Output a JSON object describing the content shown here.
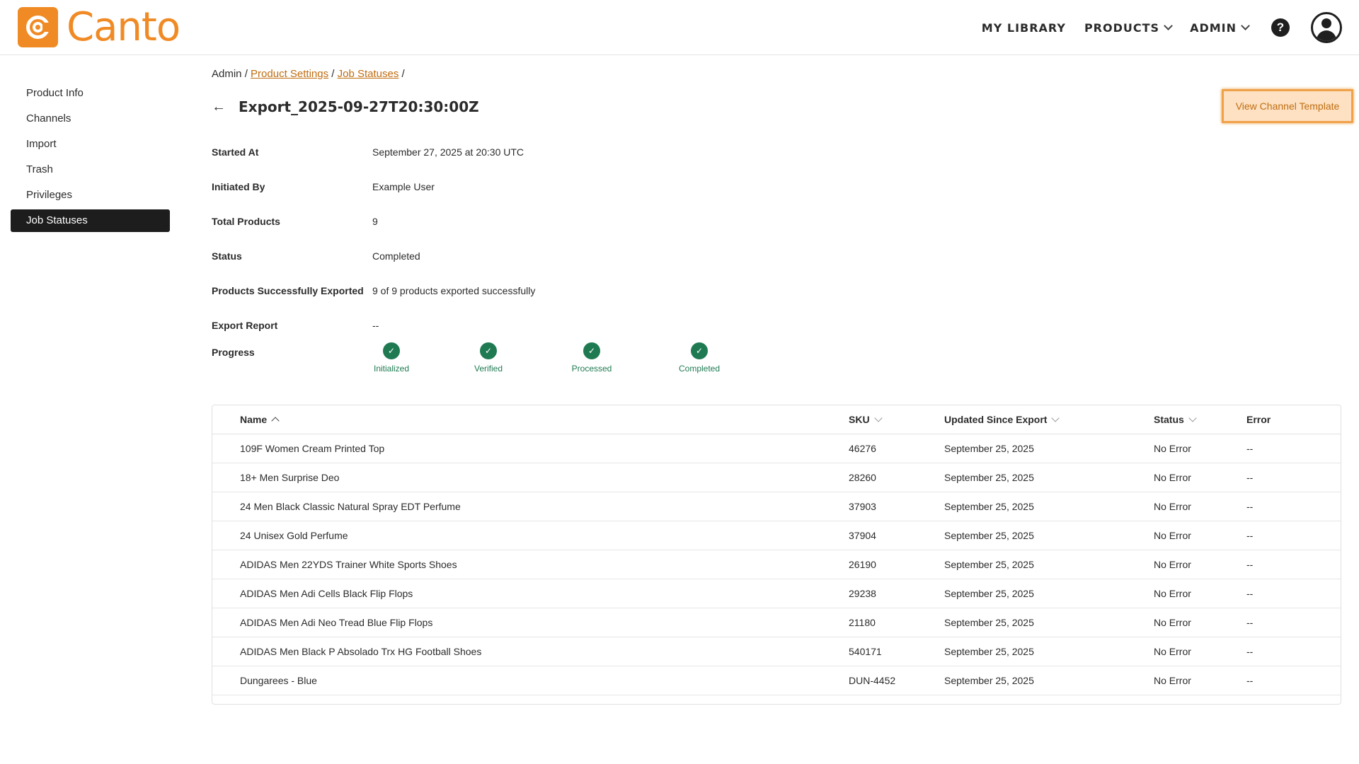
{
  "brand": {
    "name": "Canto",
    "color": "#f08a24"
  },
  "topnav": {
    "items": [
      {
        "label": "MY LIBRARY",
        "dropdown": false
      },
      {
        "label": "PRODUCTS",
        "dropdown": true
      },
      {
        "label": "ADMIN",
        "dropdown": true
      }
    ],
    "help_icon": "question-circle-icon",
    "avatar_icon": "user-avatar-icon"
  },
  "sidebar": {
    "items": [
      {
        "label": "Product Info",
        "active": false
      },
      {
        "label": "Channels",
        "active": false
      },
      {
        "label": "Import",
        "active": false
      },
      {
        "label": "Trash",
        "active": false
      },
      {
        "label": "Privileges",
        "active": false
      },
      {
        "label": "Job Statuses",
        "active": true
      }
    ]
  },
  "breadcrumb": {
    "root": "Admin",
    "links": [
      "Product Settings",
      "Job Statuses"
    ],
    "separator": "/"
  },
  "page": {
    "title": "Export_2025-09-27T20:30:00Z",
    "view_template_label": "View Channel Template"
  },
  "details": [
    {
      "label": "Started At",
      "value": "September 27, 2025 at 20:30 UTC"
    },
    {
      "label": "Initiated By",
      "value": "Example User"
    },
    {
      "label": "Total Products",
      "value": "9"
    },
    {
      "label": "Status",
      "value": "Completed"
    },
    {
      "label": "Products Successfully Exported",
      "value": "9 of 9 products exported successfully"
    },
    {
      "label": "Export Report",
      "value": "--"
    }
  ],
  "progress": {
    "label": "Progress",
    "steps": [
      "Initialized",
      "Verified",
      "Processed",
      "Completed"
    ],
    "color": "#1f7a52"
  },
  "table": {
    "columns": [
      "Name",
      "SKU",
      "Updated Since Export",
      "Status",
      "Error"
    ],
    "rows": [
      {
        "name": "109F Women Cream Printed Top",
        "sku": "46276",
        "updated": "September 25, 2025",
        "status": "No Error",
        "error": "--"
      },
      {
        "name": "18+ Men Surprise Deo",
        "sku": "28260",
        "updated": "September 25, 2025",
        "status": "No Error",
        "error": "--"
      },
      {
        "name": "24 Men Black Classic Natural Spray EDT Perfume",
        "sku": "37903",
        "updated": "September 25, 2025",
        "status": "No Error",
        "error": "--"
      },
      {
        "name": "24 Unisex Gold Perfume",
        "sku": "37904",
        "updated": "September 25, 2025",
        "status": "No Error",
        "error": "--"
      },
      {
        "name": "ADIDAS Men 22YDS Trainer White Sports Shoes",
        "sku": "26190",
        "updated": "September 25, 2025",
        "status": "No Error",
        "error": "--"
      },
      {
        "name": "ADIDAS Men Adi Cells Black Flip Flops",
        "sku": "29238",
        "updated": "September 25, 2025",
        "status": "No Error",
        "error": "--"
      },
      {
        "name": "ADIDAS Men Adi Neo Tread Blue Flip Flops",
        "sku": "21180",
        "updated": "September 25, 2025",
        "status": "No Error",
        "error": "--"
      },
      {
        "name": "ADIDAS Men Black P Absolado Trx HG Football Shoes",
        "sku": "540171",
        "updated": "September 25, 2025",
        "status": "No Error",
        "error": "--"
      },
      {
        "name": "Dungarees - Blue",
        "sku": "DUN-4452",
        "updated": "September 25, 2025",
        "status": "No Error",
        "error": "--"
      }
    ]
  }
}
